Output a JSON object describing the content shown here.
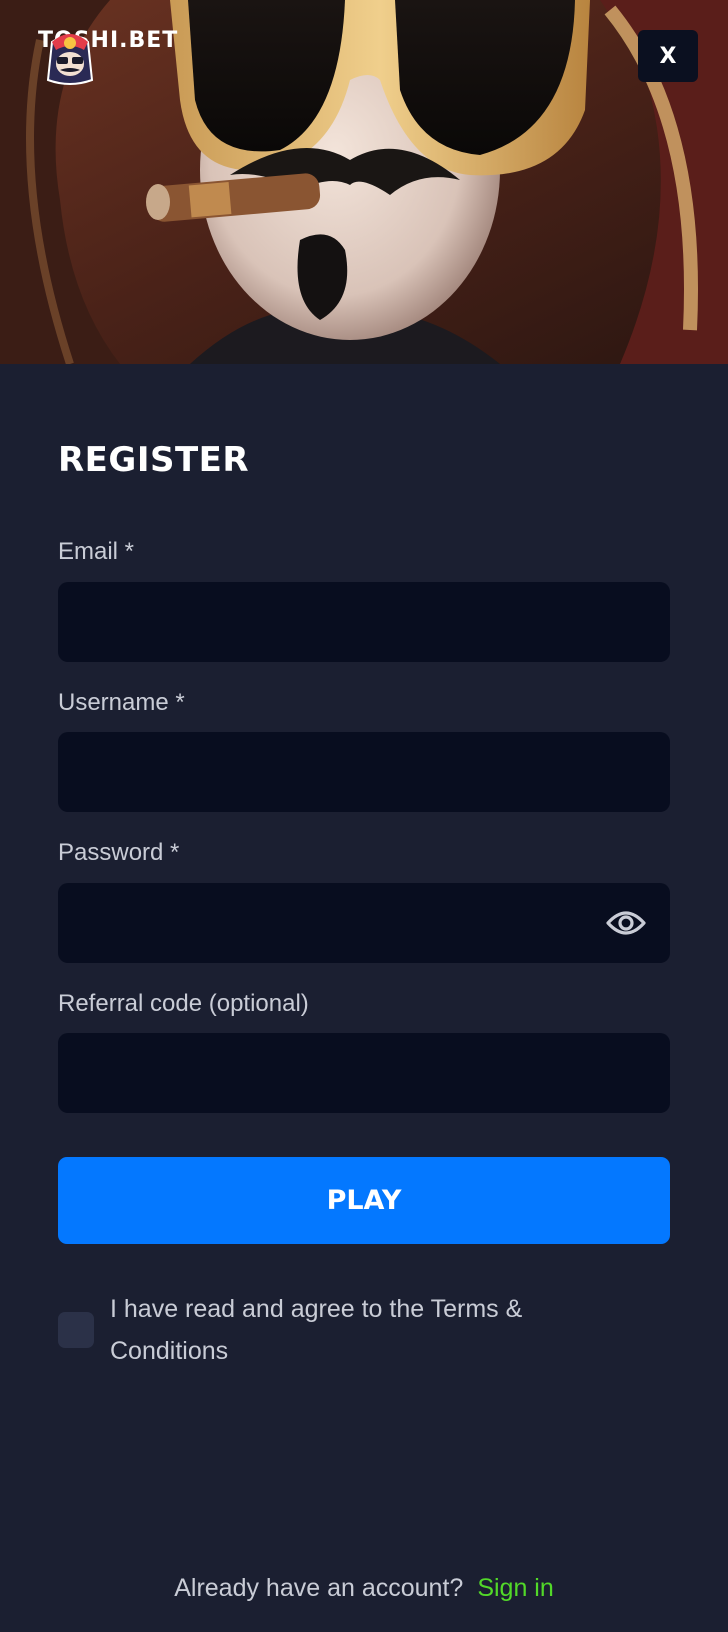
{
  "brand": {
    "name": "TOSHI.BET"
  },
  "header": {
    "close_label": "X"
  },
  "form": {
    "title": "REGISTER",
    "email": {
      "label": "Email *",
      "value": ""
    },
    "username": {
      "label": "Username *",
      "value": ""
    },
    "password": {
      "label": "Password *",
      "value": "",
      "toggle_icon": "eye-icon"
    },
    "referral": {
      "label": "Referral code (optional)",
      "value": ""
    },
    "submit_label": "PLAY",
    "terms_label": "I have read and agree to the Terms & Conditions",
    "terms_checked": false
  },
  "footer": {
    "question": "Already have an account?",
    "signin_label": "Sign in"
  },
  "colors": {
    "background": "#1b1f31",
    "input_bg": "#080d1f",
    "primary_button": "#0478ff",
    "link": "#52d829"
  }
}
